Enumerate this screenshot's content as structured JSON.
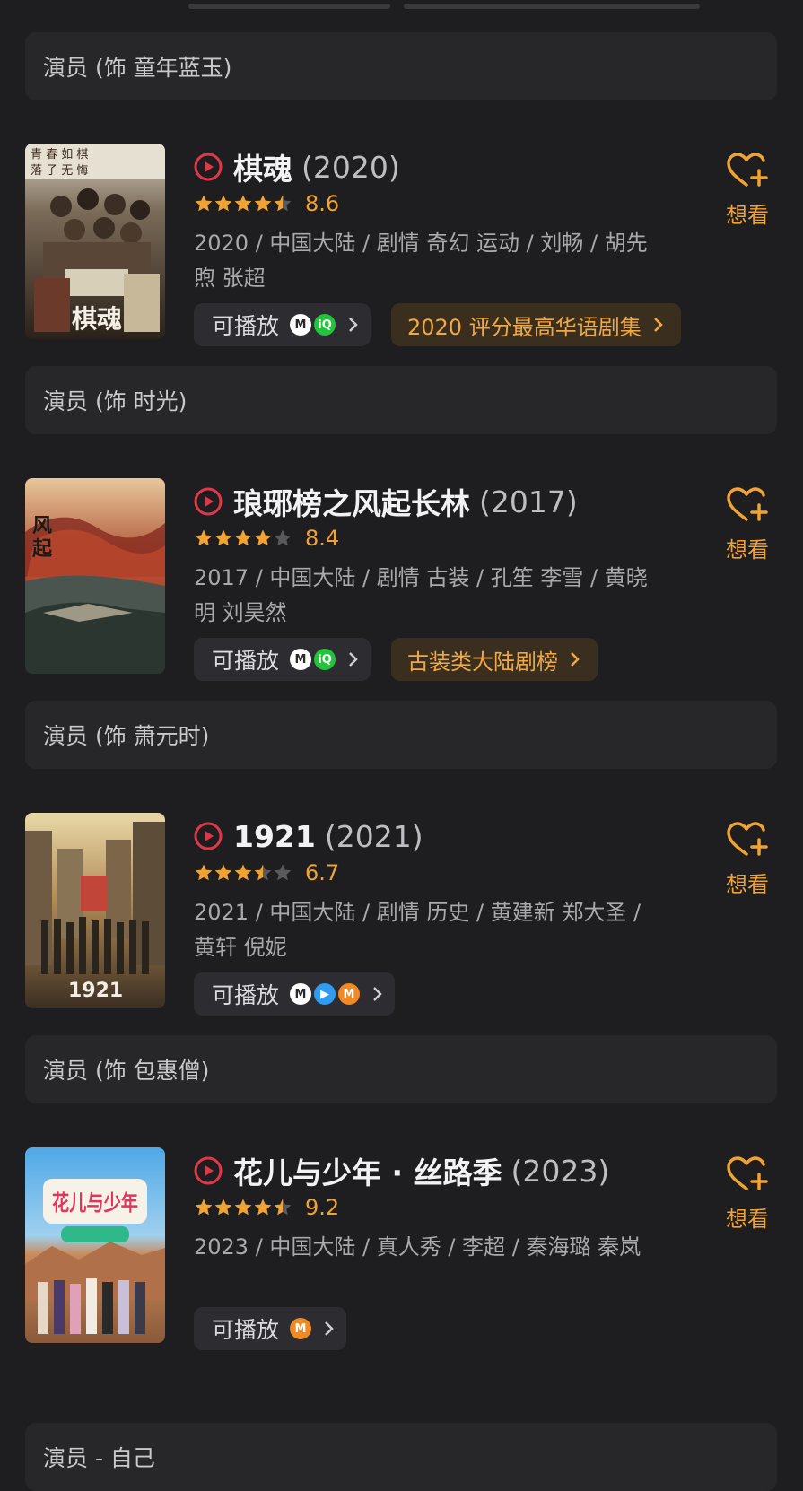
{
  "role_bars": [
    "演员 (饰 童年蓝玉)",
    "演员 (饰 时光)",
    "演员 (饰 萧元时)",
    "演员 (饰 包惠僧)",
    "演员 - 自己"
  ],
  "items": [
    {
      "title": "棋魂",
      "year": "(2020)",
      "rating_stars": 4.5,
      "score": "8.6",
      "meta": "2020 / 中国大陆 / 剧情 奇幻 运动 / 刘畅 / 胡先煦 张超",
      "play_label": "可播放",
      "platforms": [
        "youku-icon",
        "iqiyi-icon"
      ],
      "rank": "2020 评分最高华语剧集",
      "want_label": "想看",
      "poster_text": "棋魂"
    },
    {
      "title": "琅琊榜之风起长林",
      "year": "(2017)",
      "rating_stars": 4,
      "score": "8.4",
      "meta": "2017 / 中国大陆 / 剧情 古装 / 孔笙 李雪 / 黄晓明 刘昊然",
      "play_label": "可播放",
      "platforms": [
        "youku-icon",
        "iqiyi-icon"
      ],
      "rank": "古装类大陆剧榜",
      "want_label": "想看",
      "poster_text": ""
    },
    {
      "title": "1921",
      "year": "(2021)",
      "rating_stars": 3.5,
      "score": "6.7",
      "meta": "2021 / 中国大陆 / 剧情 历史 / 黄建新 郑大圣 / 黄轩 倪妮",
      "play_label": "可播放",
      "platforms": [
        "youku-icon",
        "tencent-video-icon",
        "mango-tv-icon"
      ],
      "rank": "",
      "want_label": "想看",
      "poster_text": "1921"
    },
    {
      "title": "花儿与少年 · 丝路季",
      "year": "(2023)",
      "rating_stars": 4.5,
      "score": "9.2",
      "meta": "2023 / 中国大陆 / 真人秀 / 李超 / 秦海璐 秦岚",
      "play_label": "可播放",
      "platforms": [
        "mango-tv-icon"
      ],
      "rank": "",
      "want_label": "想看",
      "poster_text": "花儿与少年"
    }
  ],
  "colors": {
    "background": "#1e1e20",
    "card": "#27272a",
    "accent": "#f0a233",
    "play_red": "#e0374a"
  }
}
